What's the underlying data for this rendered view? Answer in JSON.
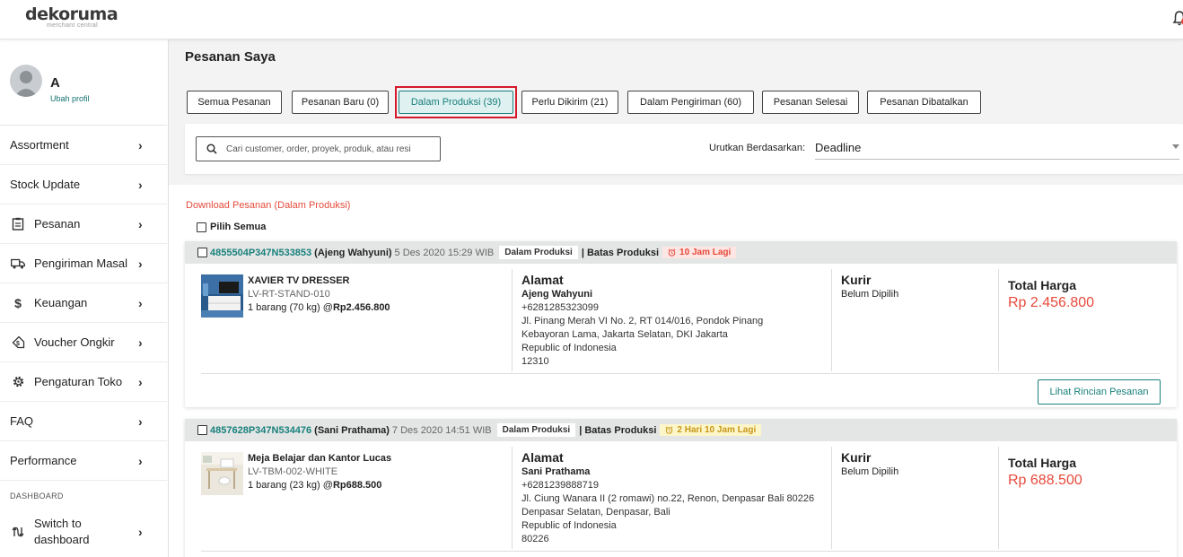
{
  "brand": {
    "name": "dekoruma",
    "sub": "merchant central"
  },
  "profile": {
    "name": "A",
    "edit_label": "Ubah profil"
  },
  "sidebar": {
    "items": [
      {
        "label": "Assortment",
        "icon": "none"
      },
      {
        "label": "Stock Update",
        "icon": "none"
      },
      {
        "label": "Pesanan",
        "icon": "clipboard-icon"
      },
      {
        "label": "Pengiriman Masal",
        "icon": "truck-icon"
      },
      {
        "label": "Keuangan",
        "icon": "dollar-icon"
      },
      {
        "label": "Voucher Ongkir",
        "icon": "voucher-tag-icon"
      },
      {
        "label": "Pengaturan Toko",
        "icon": "gear-icon"
      },
      {
        "label": "FAQ",
        "icon": "none"
      },
      {
        "label": "Performance",
        "icon": "none"
      }
    ],
    "section_label": "DASHBOARD",
    "switch_label_1": "Switch to",
    "switch_label_2": "dashboard"
  },
  "main": {
    "title": "Pesanan Saya",
    "tabs": [
      {
        "label": "Semua Pesanan",
        "active": false
      },
      {
        "label": "Pesanan Baru (0)",
        "active": false
      },
      {
        "label": "Dalam Produksi (39)",
        "active": true
      },
      {
        "label": "Perlu Dikirim (21)",
        "active": false
      },
      {
        "label": "Dalam Pengiriman (60)",
        "active": false
      },
      {
        "label": "Pesanan Selesai",
        "active": false
      },
      {
        "label": "Pesanan Dibatalkan",
        "active": false
      }
    ],
    "search_placeholder": "Cari customer, order, proyek, produk, atau resi",
    "sort_label": "Urutkan Berdasarkan:",
    "sort_value": "Deadline",
    "download_link": "Download Pesanan (Dalam Produksi)",
    "select_all": "Pilih Semua"
  },
  "orders": [
    {
      "id": "4855504P347N533853",
      "customer": "(Ajeng Wahyuni)",
      "date": "5 Des 2020 15:29 WIB",
      "status": "Dalam Produksi",
      "batas_label": "| Batas Produksi",
      "deadline": "10 Jam Lagi",
      "deadline_color": "#e64a3b",
      "product_name": "XAVIER TV DRESSER",
      "sku": "LV-RT-STAND-010",
      "qty_text": "1 barang (70 kg) @",
      "unit_price": "Rp2.456.800",
      "address_title": "Alamat",
      "addr_name": "Ajeng Wahyuni",
      "addr_lines": [
        "+6281285323099",
        "Jl. Pinang Merah VI No. 2, RT 014/016, Pondok Pinang",
        "Kebayoran Lama, Jakarta Selatan, DKI Jakarta",
        "Republic of Indonesia",
        "12310"
      ],
      "courier_title": "Kurir",
      "courier_value": "Belum Dipilih",
      "total_title": "Total Harga",
      "total_value": "Rp 2.456.800",
      "detail_button": "Lihat Rincian Pesanan"
    },
    {
      "id": "4857628P347N534476",
      "customer": "(Sani Prathama)",
      "date": "7 Des 2020 14:51 WIB",
      "status": "Dalam Produksi",
      "batas_label": "| Batas Produksi",
      "deadline": "2 Hari 10 Jam Lagi",
      "deadline_color": "#c7971a",
      "product_name": "Meja Belajar dan Kantor Lucas",
      "sku": "LV-TBM-002-WHITE",
      "qty_text": "1 barang (23 kg) @",
      "unit_price": "Rp688.500",
      "address_title": "Alamat",
      "addr_name": "Sani Prathama",
      "addr_lines": [
        "+6281239888719",
        "Jl. Ciung Wanara II (2 romawi) no.22, Renon, Denpasar Bali 80226",
        "Denpasar Selatan, Denpasar, Bali",
        "Republic of Indonesia",
        "80226"
      ],
      "courier_title": "Kurir",
      "courier_value": "Belum Dipilih",
      "total_title": "Total Harga",
      "total_value": "Rp 688.500"
    }
  ],
  "colors": {
    "accent": "#19807b",
    "price": "#e64a3b",
    "highlight": "#d5192b"
  }
}
